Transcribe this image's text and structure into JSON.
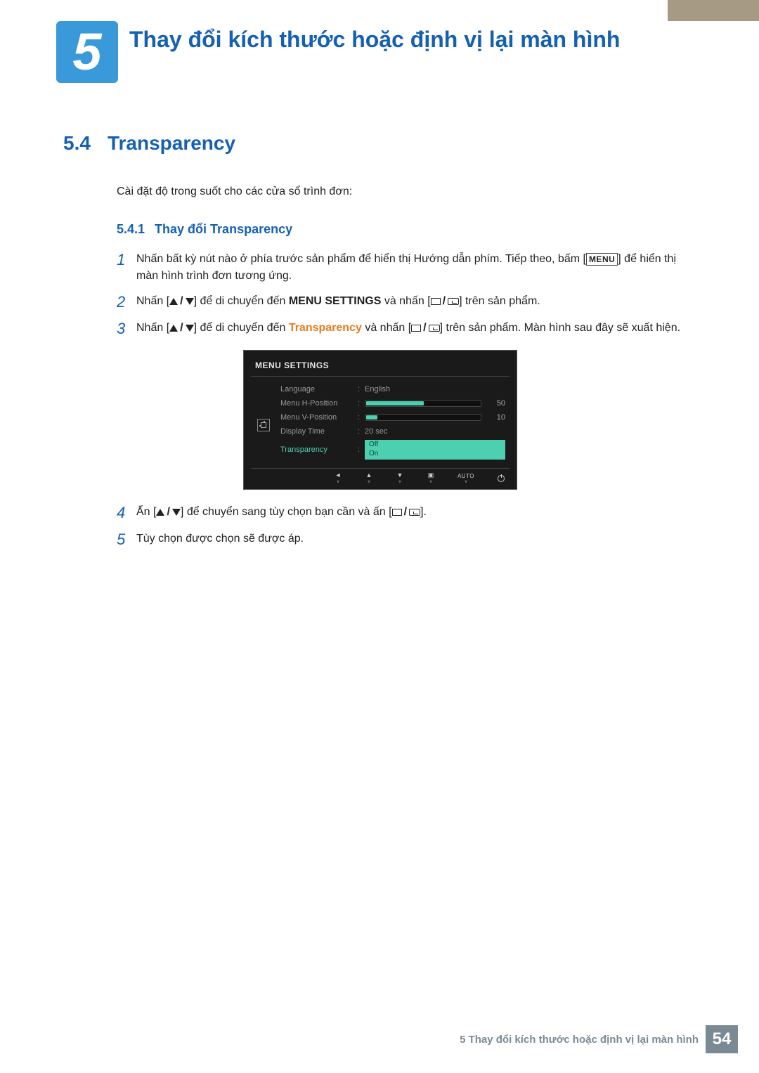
{
  "chapter": {
    "number": "5",
    "title": "Thay đổi kích thước hoặc định vị lại màn hình"
  },
  "section": {
    "number": "5.4",
    "title": "Transparency"
  },
  "intro": "Cài đặt độ trong suốt cho các cửa sổ trình đơn:",
  "subsection": {
    "number": "5.4.1",
    "title": "Thay đổi Transparency"
  },
  "steps": {
    "s1_a": "Nhấn bất kỳ nút nào ở phía trước sản phẩm để hiển thị Hướng dẫn phím. Tiếp theo, bấm [",
    "s1_menu": "MENU",
    "s1_b": "] để hiển thị màn hình trình đơn tương ứng.",
    "s2_a": "Nhấn [",
    "s2_b": "] để di chuyển đến ",
    "s2_kw": "MENU SETTINGS",
    "s2_c": " và nhấn [",
    "s2_d": "] trên sản phẩm.",
    "s3_a": "Nhấn [",
    "s3_b": "] để di chuyển đến ",
    "s3_kw": "Transparency",
    "s3_c": " và nhấn [",
    "s3_d": "] trên sản phẩm. Màn hình sau đây sẽ xuất hiện.",
    "s4_a": "Ấn [",
    "s4_b": "] để chuyển sang tùy chọn bạn cần và ấn [",
    "s4_c": "].",
    "s5": "Tùy chọn được chọn sẽ được áp."
  },
  "osd": {
    "title": "MENU SETTINGS",
    "rows": {
      "language": {
        "label": "Language",
        "value": "English"
      },
      "hpos": {
        "label": "Menu H-Position",
        "value": "50",
        "pct": 50
      },
      "vpos": {
        "label": "Menu V-Position",
        "value": "10",
        "pct": 10
      },
      "dtime": {
        "label": "Display Time",
        "value": "20 sec"
      },
      "trans": {
        "label": "Transparency",
        "off": "Off",
        "on": "On"
      }
    },
    "auto": "AUTO"
  },
  "footer": {
    "text": "5 Thay đổi kích thước hoặc định vị lại màn hình",
    "page": "54"
  }
}
